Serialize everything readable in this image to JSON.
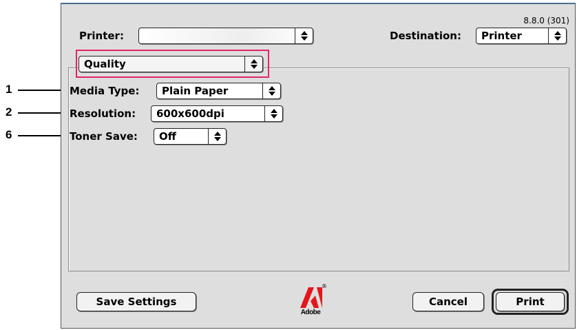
{
  "window": {
    "version": "8.8.0 (301)"
  },
  "header": {
    "printer_label": "Printer:",
    "printer_value": "",
    "destination_label": "Destination:",
    "destination_value": "Printer"
  },
  "panel_select": {
    "value": "Quality"
  },
  "settings": [
    {
      "label": "Media Type:",
      "value": "Plain Paper",
      "callout": "1"
    },
    {
      "label": "Resolution:",
      "value": "600x600dpi",
      "callout": "2"
    },
    {
      "label": "Toner Save:",
      "value": "Off",
      "callout": "6"
    }
  ],
  "footer": {
    "save_settings": "Save Settings",
    "logo_text": "Adobe",
    "cancel": "Cancel",
    "print": "Print"
  },
  "colors": {
    "highlight": "#e2246a",
    "adobe_red": "#e3161b",
    "dialog_bg": "#dedede"
  }
}
